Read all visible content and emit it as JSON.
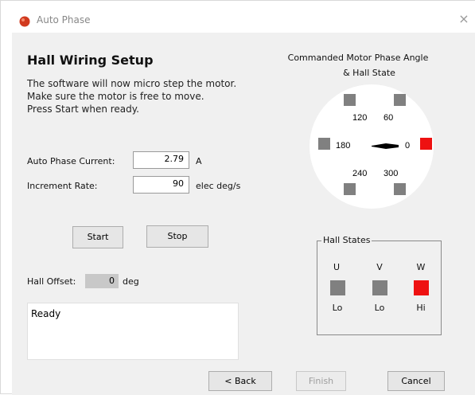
{
  "window": {
    "title": "Auto Phase",
    "close_glyph": "×"
  },
  "heading": "Hall Wiring Setup",
  "instructions": [
    "The software will now micro step the motor.",
    "Make sure the motor is free to move.",
    "Press Start when ready."
  ],
  "fields": {
    "current": {
      "label": "Auto Phase Current:",
      "value": "2.79",
      "unit": "A"
    },
    "rate": {
      "label": "Increment Rate:",
      "value": "90",
      "unit": "elec deg/s"
    }
  },
  "buttons": {
    "start": "Start",
    "stop": "Stop",
    "back": "< Back",
    "finish": "Finish",
    "cancel": "Cancel"
  },
  "hall_offset": {
    "label": "Hall Offset:",
    "value": "0",
    "unit": "deg"
  },
  "status_text": "Ready",
  "diagram": {
    "title_line1": "Commanded Motor Phase Angle",
    "title_line2": "& Hall State",
    "angle_labels": {
      "a120": "120",
      "a60": "60",
      "a180": "180",
      "a0": "0",
      "a240": "240",
      "a300": "300"
    },
    "commanded_angle_deg": 0,
    "positions": [
      {
        "angle": "120",
        "active": false
      },
      {
        "angle": "60",
        "active": false
      },
      {
        "angle": "180",
        "active": false
      },
      {
        "angle": "0",
        "active": true
      },
      {
        "angle": "240",
        "active": false
      },
      {
        "angle": "300",
        "active": false
      }
    ]
  },
  "hall_states": {
    "title": "Hall States",
    "items": [
      {
        "name": "U",
        "state": "Lo",
        "active": false
      },
      {
        "name": "V",
        "state": "Lo",
        "active": false
      },
      {
        "name": "W",
        "state": "Hi",
        "active": true
      }
    ]
  },
  "colors": {
    "active": "#ee1111",
    "inactive": "#808080",
    "background": "#f0f0f0"
  },
  "icons": {
    "app": "app-icon",
    "close": "close-icon"
  }
}
